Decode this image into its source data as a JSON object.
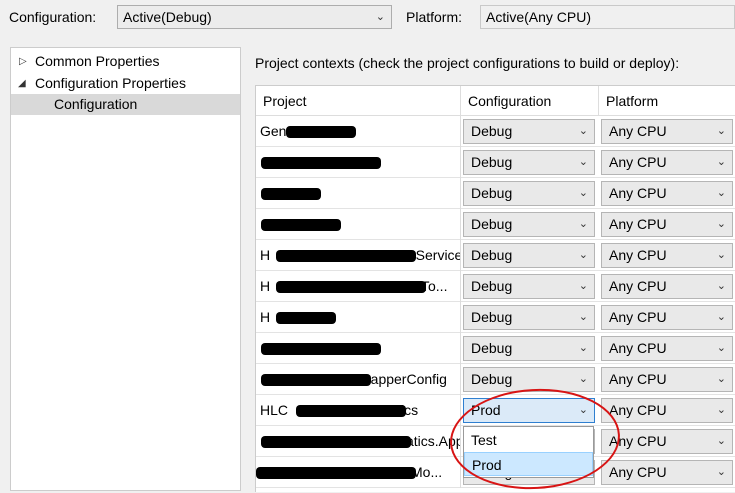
{
  "top": {
    "config_label": "Configuration:",
    "config_value": "Active(Debug)",
    "platform_label": "Platform:",
    "platform_value": "Active(Any CPU)"
  },
  "tree": {
    "items": [
      {
        "label": "Common Properties",
        "expanded": false
      },
      {
        "label": "Configuration Properties",
        "expanded": true
      },
      {
        "label": "Configuration",
        "selected": true
      }
    ]
  },
  "contexts_label": "Project contexts (check the project configurations to build or deploy):",
  "grid": {
    "headers": [
      "Project",
      "Configuration",
      "Platform"
    ],
    "rows": [
      {
        "name_prefix": "Gen",
        "name_suffix": "",
        "config": "Debug",
        "platform": "Any CPU"
      },
      {
        "name_prefix": "",
        "name_suffix": "",
        "config": "Debug",
        "platform": "Any CPU"
      },
      {
        "name_prefix": "",
        "name_suffix": "",
        "config": "Debug",
        "platform": "Any CPU"
      },
      {
        "name_prefix": "",
        "name_suffix": "",
        "config": "Debug",
        "platform": "Any CPU"
      },
      {
        "name_prefix": "H",
        "name_suffix": "rService",
        "config": "Debug",
        "platform": "Any CPU"
      },
      {
        "name_prefix": "H",
        "name_suffix": "To...",
        "config": "Debug",
        "platform": "Any CPU"
      },
      {
        "name_prefix": "H",
        "name_suffix": "",
        "config": "Debug",
        "platform": "Any CPU"
      },
      {
        "name_prefix": "",
        "name_suffix": "",
        "config": "Debug",
        "platform": "Any CPU"
      },
      {
        "name_prefix": "",
        "name_suffix": "rapperConfig",
        "config": "Debug",
        "platform": "Any CPU"
      },
      {
        "name_prefix": "HLC",
        "name_suffix": "ics",
        "config": "Prod",
        "platform": "Any CPU",
        "open": true
      },
      {
        "name_prefix": "",
        "name_suffix": "atics.Applicati...",
        "config": "",
        "platform": "Any CPU"
      },
      {
        "name_prefix": "",
        "name_suffix": "Mo...",
        "config": "Debug",
        "platform": "Any CPU"
      }
    ]
  },
  "dropdown": {
    "options": [
      "Test",
      "Prod"
    ],
    "highlighted": "Prod"
  },
  "colors": {
    "annotation": "#d81414",
    "hover": "#cce8ff"
  }
}
